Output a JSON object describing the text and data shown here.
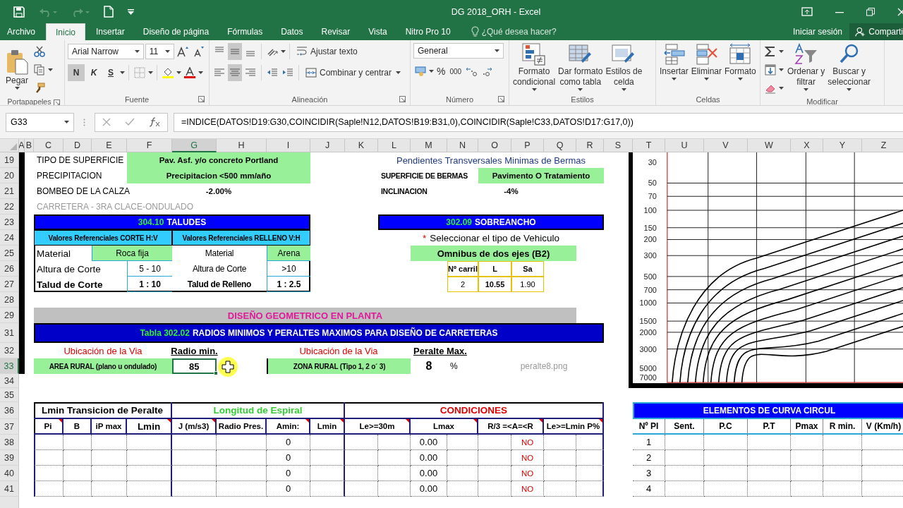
{
  "window": {
    "title": "DG 2018_ORH - Excel"
  },
  "tabs": [
    {
      "label": "Archivo",
      "selected": false
    },
    {
      "label": "Inicio",
      "selected": true
    },
    {
      "label": "Insertar",
      "selected": false
    },
    {
      "label": "Diseño de página",
      "selected": false
    },
    {
      "label": "Fórmulas",
      "selected": false
    },
    {
      "label": "Datos",
      "selected": false
    },
    {
      "label": "Revisar",
      "selected": false
    },
    {
      "label": "Vista",
      "selected": false
    },
    {
      "label": "Nitro Pro 10",
      "selected": false
    }
  ],
  "tell_me": {
    "placeholder": "¿Qué desea hacer?"
  },
  "account": {
    "sign_in": "Iniciar sesión",
    "share": "Comparti"
  },
  "ribbon": {
    "groups": [
      {
        "kind": "clipboard",
        "label": "Portapapeles",
        "paste": "Pegar"
      },
      {
        "kind": "font",
        "label": "Fuente",
        "font_name": "Arial Narrow",
        "font_size": "11",
        "bold_label": "N",
        "italic_label": "K",
        "underline_label": "S",
        "bold": true,
        "italic": false,
        "underline": false
      },
      {
        "kind": "alignment",
        "label": "Alineación",
        "wrap": "Ajustar texto",
        "merge": "Combinar y centrar",
        "vertical_buttons": [
          {
            "selected": false
          },
          {
            "selected": true
          },
          {
            "selected": false
          }
        ],
        "horizontal_buttons": [
          {
            "selected": false
          },
          {
            "selected": true
          },
          {
            "selected": false
          }
        ]
      },
      {
        "kind": "number",
        "label": "Número",
        "format": "General",
        "percent": "%",
        "thousands": "000"
      },
      {
        "kind": "styles",
        "label": "Estilos",
        "buttons": [
          {
            "lines": [
              "Formato",
              "condicional"
            ]
          },
          {
            "lines": [
              "Dar formato",
              "como tabla"
            ]
          },
          {
            "lines": [
              "Estilos de",
              "celda"
            ]
          }
        ]
      },
      {
        "kind": "cells",
        "label": "Celdas",
        "buttons": [
          {
            "lines": [
              "Insertar"
            ]
          },
          {
            "lines": [
              "Eliminar"
            ]
          },
          {
            "lines": [
              "Formato"
            ]
          }
        ]
      },
      {
        "kind": "editing",
        "label": "Modificar",
        "buttons": [
          {
            "lines": [
              "Ordenar y",
              "filtrar"
            ]
          },
          {
            "lines": [
              "Buscar y",
              "seleccionar"
            ]
          }
        ]
      }
    ]
  },
  "formula_bar": {
    "name_box": "G33",
    "formula": "=INDICE(DATOS!D19:G30,COINCIDIR(Saple!N12,DATOS!B19:B31,0),COINCIDIR(Saple!C33,DATOS!D17:G17,0))"
  },
  "sheet": {
    "columns": [
      {
        "letter": "A",
        "selected": false
      },
      {
        "letter": "B",
        "selected": false
      },
      {
        "letter": "C",
        "selected": false
      },
      {
        "letter": "D",
        "selected": false
      },
      {
        "letter": "E",
        "selected": false
      },
      {
        "letter": "F",
        "selected": false
      },
      {
        "letter": "G",
        "selected": true
      },
      {
        "letter": "H",
        "selected": false
      },
      {
        "letter": "I",
        "selected": false
      },
      {
        "letter": "J",
        "selected": false
      },
      {
        "letter": "K",
        "selected": false
      },
      {
        "letter": "L",
        "selected": false
      },
      {
        "letter": "M",
        "selected": false
      },
      {
        "letter": "N",
        "selected": false
      },
      {
        "letter": "O",
        "selected": false
      },
      {
        "letter": "P",
        "selected": false
      },
      {
        "letter": "Q",
        "selected": false
      },
      {
        "letter": "R",
        "selected": false
      },
      {
        "letter": "S",
        "selected": false
      },
      {
        "letter": "T",
        "selected": false
      },
      {
        "letter": "U",
        "selected": false
      },
      {
        "letter": "V",
        "selected": false
      },
      {
        "letter": "W",
        "selected": false
      },
      {
        "letter": "X",
        "selected": false
      },
      {
        "letter": "Y",
        "selected": false
      },
      {
        "letter": "Z",
        "selected": false
      }
    ],
    "rows": [
      {
        "number": "19",
        "selected": false
      },
      {
        "number": "20",
        "selected": false
      },
      {
        "number": "21",
        "selected": false
      },
      {
        "number": "22",
        "selected": false
      },
      {
        "number": "23",
        "selected": false
      },
      {
        "number": "24",
        "selected": false
      },
      {
        "number": "25",
        "selected": false
      },
      {
        "number": "26",
        "selected": false
      },
      {
        "number": "27",
        "selected": false
      },
      {
        "number": "28",
        "selected": false
      },
      {
        "number": "29",
        "selected": false
      },
      {
        "number": "31",
        "selected": false
      },
      {
        "number": "32",
        "selected": false
      },
      {
        "number": "33",
        "selected": true
      },
      {
        "number": "34",
        "selected": false
      },
      {
        "number": "35",
        "selected": false
      },
      {
        "number": "36",
        "selected": false
      },
      {
        "number": "37",
        "selected": false
      },
      {
        "number": "38",
        "selected": false
      },
      {
        "number": "39",
        "selected": false
      },
      {
        "number": "40",
        "selected": false
      },
      {
        "number": "41",
        "selected": false
      }
    ]
  },
  "surface": {
    "rows": [
      {
        "label": "TIPO DE SUPERFICIE",
        "value": "Pav. Asf. y/o concreto Portland",
        "highlighted": true
      },
      {
        "label": "PRECIPITACION",
        "value": "Precipitacion <500 mm/año",
        "highlighted": true
      },
      {
        "label": "BOMBEO DE LA CALZA",
        "value": "-2.00%",
        "highlighted": false
      }
    ],
    "note": "CARRETERA - 3RA CLACE-ONDULADO"
  },
  "berms": {
    "title": "Pendientes Transversales Minimas de Bermas",
    "rows": [
      {
        "label": "SUPERFICIE DE BERMAS",
        "value": "Pavimento O Tratamiento",
        "highlighted": true
      },
      {
        "label": "INCLINACION",
        "value": "-4%",
        "highlighted": false
      }
    ]
  },
  "taludes": {
    "code": "304.10",
    "title": "TALUDES",
    "corte": {
      "header": "Valores Referenciales CORTE H:V",
      "rows": [
        {
          "label": "Material",
          "value": "Roca fija",
          "highlighted": true,
          "bold": false
        },
        {
          "label": "Altura de Corte",
          "value": "5 - 10",
          "highlighted": false,
          "bold": false
        },
        {
          "label": "Talud de Corte",
          "value": "1 : 10",
          "highlighted": false,
          "bold": true
        }
      ]
    },
    "relleno": {
      "header": "Valores Referenciales RELLENO V:H",
      "rows": [
        {
          "label": "Material",
          "value": "Arena",
          "highlighted": true,
          "bold": false
        },
        {
          "label": "Altura de Corte",
          "value": ">10",
          "highlighted": false,
          "bold": false
        },
        {
          "label": "Talud de Relleno",
          "value": "1 : 2.5",
          "highlighted": false,
          "bold": true
        }
      ]
    }
  },
  "sobreancho": {
    "code": "302.09",
    "title": "SOBREANCHO",
    "note_mark": "*",
    "note": "Seleccionar el tipo de Vehiculo",
    "vehicle": "Omnibus de dos ejes (B2)",
    "columns": [
      "Nº carril",
      "L",
      "Sa"
    ],
    "values": [
      "2",
      "10.55",
      "1.90"
    ]
  },
  "planta": {
    "title": "DISEÑO GEOMETRICO EN PLANTA"
  },
  "radios": {
    "code": "Tabla 302.02",
    "title": "RADIOS MINIMOS Y PERALTES MAXIMOS PARA DISEÑO DE CARRETERAS",
    "left": {
      "location_label": "Ubicación de la Via",
      "location": "AREA RURAL (plano u ondulado)",
      "value_label": "Radio min.",
      "value": "85"
    },
    "right": {
      "location_label": "Ubicación de la Via",
      "location": "ZONA RURAL (Tipo 1, 2 o´ 3)",
      "value_label": "Peralte Max.",
      "value": "8",
      "unit": "%"
    },
    "image_name": "peralte8.png"
  },
  "nomogram": {
    "y_ticks": [
      "30",
      "50",
      "70",
      "100",
      "150",
      "200",
      "300",
      "500",
      "700",
      "1000",
      "1500",
      "2000",
      "3000",
      "5000",
      "7000"
    ]
  },
  "transition": {
    "groups": [
      {
        "label": "Lmin Transicion de Peralte",
        "color": "#000000"
      },
      {
        "label": "Longitud de Espiral",
        "color": "#33cc33"
      },
      {
        "label": "CONDICIONES",
        "color": "#e00000"
      }
    ],
    "columns": [
      {
        "label": "Pi",
        "comment": true
      },
      {
        "label": "B",
        "comment": false
      },
      {
        "label": "iP max",
        "comment": false
      },
      {
        "label": "Lmin",
        "comment": true
      },
      {
        "label": "J (m/s3)",
        "comment": true
      },
      {
        "label": "Radio Pres.",
        "comment": false
      },
      {
        "label": "Amin:",
        "comment": true
      },
      {
        "label": "Lmin",
        "comment": true
      },
      {
        "label": "Le>=30m",
        "comment": true
      },
      {
        "label": "Lmax",
        "comment": true
      },
      {
        "label": "R/3 =<A=<R",
        "comment": true
      },
      {
        "label": "Le>=Lmin P%",
        "comment": true
      }
    ],
    "rows": [
      {
        "amin": "0",
        "lmax": "0.00",
        "check": "NO"
      },
      {
        "amin": "0",
        "lmax": "0.00",
        "check": "NO"
      },
      {
        "amin": "0",
        "lmax": "0.00",
        "check": "NO"
      },
      {
        "amin": "0",
        "lmax": "0.00",
        "check": "NO"
      }
    ]
  },
  "curve_elements": {
    "title": "ELEMENTOS DE CURVA CIRCUL",
    "columns": [
      "Nº PI",
      "Sent.",
      "P.C",
      "P.T",
      "Pmax",
      "R min.",
      "V (Km/h)"
    ],
    "rows": [
      "1",
      "2",
      "3",
      "4"
    ]
  }
}
